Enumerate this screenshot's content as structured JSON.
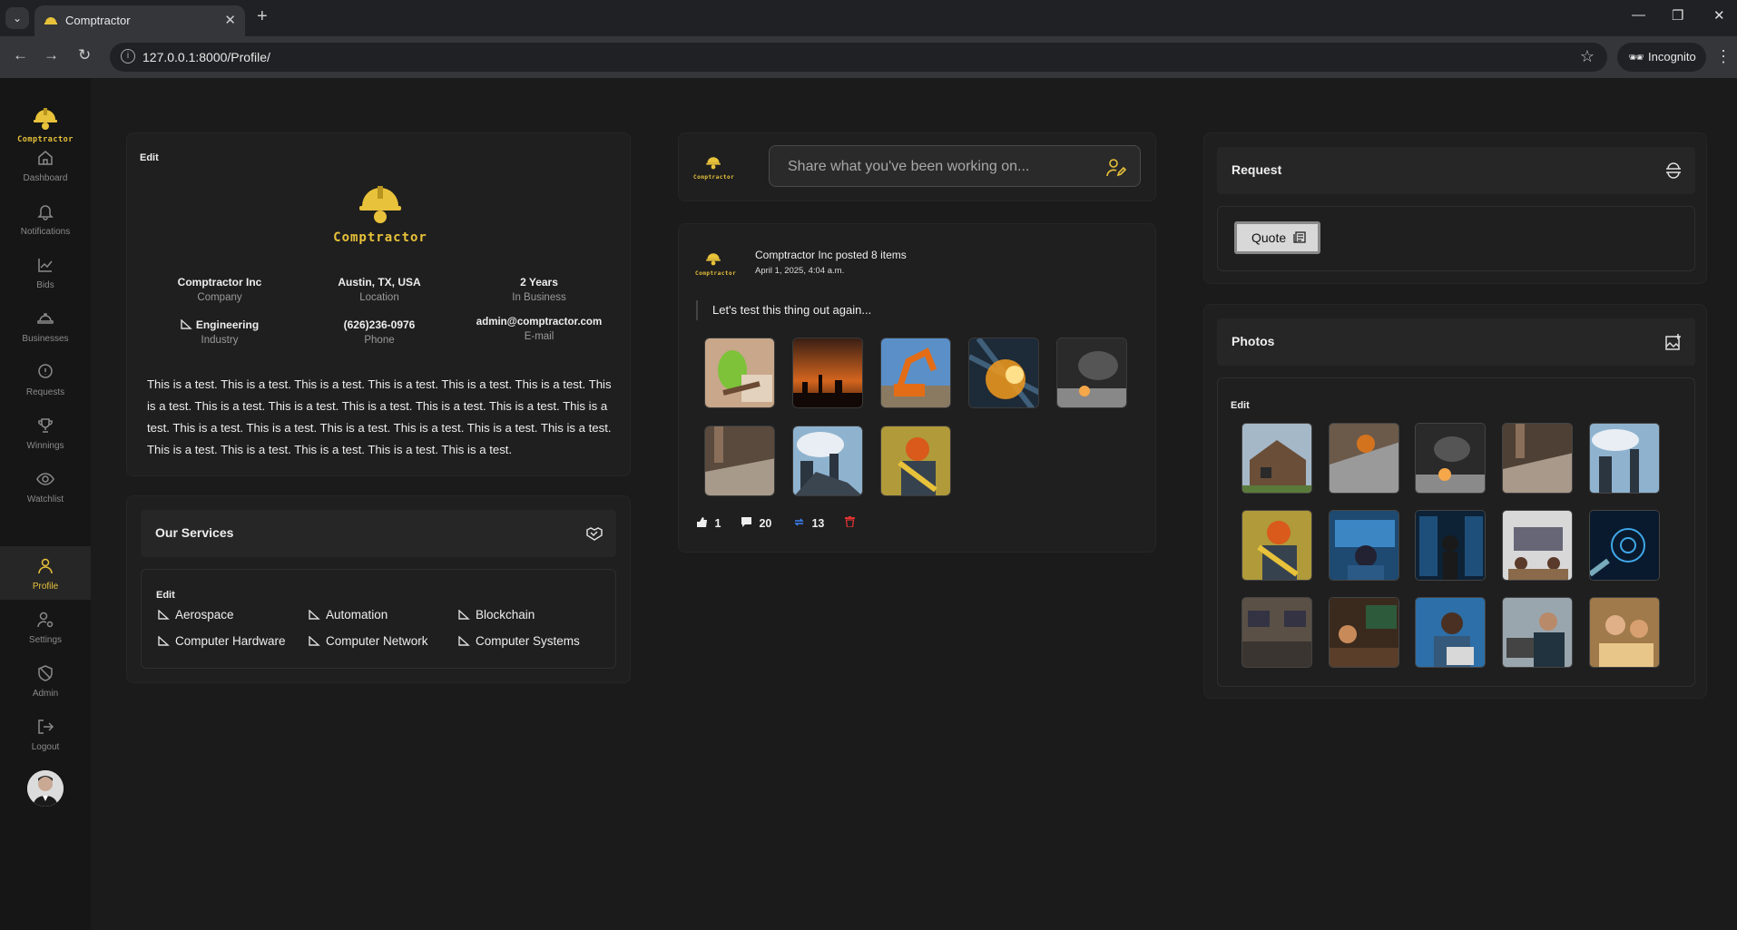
{
  "browser": {
    "tab_title": "Comptractor",
    "url": "127.0.0.1:8000/Profile/",
    "incognito_label": "Incognito"
  },
  "app": {
    "brand": "Comptractor",
    "brand_color": "#e8c23a",
    "nav": [
      {
        "label": "Dashboard",
        "icon": "home-icon"
      },
      {
        "label": "Notifications",
        "icon": "bell-icon"
      },
      {
        "label": "Bids",
        "icon": "chart-line-icon"
      },
      {
        "label": "Businesses",
        "icon": "hardhat-icon"
      },
      {
        "label": "Requests",
        "icon": "chat-icon"
      },
      {
        "label": "Winnings",
        "icon": "trophy-icon"
      },
      {
        "label": "Watchlist",
        "icon": "eye-icon"
      },
      {
        "label": "Profile",
        "icon": "user-icon",
        "active": true
      },
      {
        "label": "Settings",
        "icon": "user-gear-icon"
      },
      {
        "label": "Admin",
        "icon": "shield-icon"
      },
      {
        "label": "Logout",
        "icon": "logout-icon"
      }
    ]
  },
  "profile": {
    "edit_label": "Edit",
    "logo_word": "Comptractor",
    "company": {
      "value": "Comptractor Inc",
      "key": "Company"
    },
    "location": {
      "value": "Austin, TX, USA",
      "key": "Location"
    },
    "in_business": {
      "value": "2 Years",
      "key": "In Business"
    },
    "industry": {
      "value": "Engineering",
      "key": "Industry"
    },
    "phone": {
      "value": "(626)236-0976",
      "key": "Phone"
    },
    "email": {
      "value": "admin@comptractor.com",
      "key": "E-mail"
    },
    "description": "This is a test. This is a test. This is a test. This is a test. This is a test. This is a test. This is a test. This is a test. This is a test. This is a test. This is a test. This is a test. This is a test. This is a test. This is a test. This is a test. This is a test. This is a test. This is a test. This is a test. This is a test. This is a test. This is a test. This is a test."
  },
  "services": {
    "title": "Our Services",
    "edit_label": "Edit",
    "items": [
      "Aerospace",
      "Automation",
      "Blockchain",
      "Computer Hardware",
      "Computer Network",
      "Computer Systems"
    ]
  },
  "composer": {
    "placeholder": "Share what you've been working on..."
  },
  "post": {
    "header": "Comptractor Inc posted 8 items",
    "date": "April 1, 2025, 4:04 a.m.",
    "text": "Let's test this thing out again...",
    "likes": "1",
    "comments": "20",
    "reposts": "13",
    "accent_blue": "#3b82f6",
    "delete_red": "#d33"
  },
  "request": {
    "title": "Request",
    "quote_label": "Quote"
  },
  "photos": {
    "title": "Photos",
    "edit_label": "Edit"
  }
}
